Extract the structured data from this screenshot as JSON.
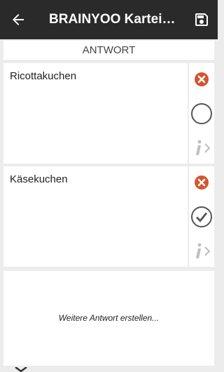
{
  "appbar": {
    "title": "BRAINYOO Karteikarten",
    "back_icon": "arrow-left-icon",
    "save_icon": "floppy-disk-icon"
  },
  "section": {
    "header": "ANTWORT"
  },
  "answers": [
    {
      "text": "Ricottakuchen",
      "correct": false,
      "delete_icon": "delete-x-icon",
      "status_icon": "empty-circle-icon",
      "info_icon": "info-chevron-icon"
    },
    {
      "text": "Käsekuchen",
      "correct": true,
      "delete_icon": "delete-x-icon",
      "status_icon": "checkmark-circle-icon",
      "info_icon": "info-chevron-icon"
    }
  ],
  "new_answer": {
    "label": "Weitere Antwort erstellen..."
  },
  "colors": {
    "appbar": "#2a2a2a",
    "delete_red": "#d4552f",
    "background": "#ececec",
    "icon_gray": "#555555",
    "info_gray": "#bdbdbd"
  }
}
